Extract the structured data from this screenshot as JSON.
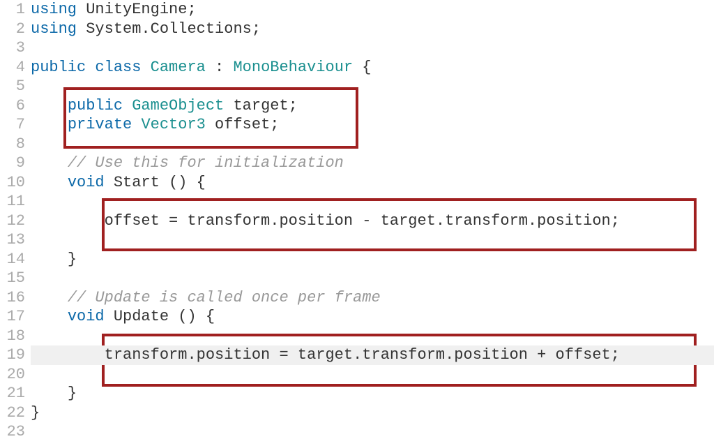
{
  "lines": {
    "l1": {
      "using": "using",
      "ns": "UnityEngine",
      "semi": ";"
    },
    "l2": {
      "using": "using",
      "ns": "System.Collections",
      "semi": ";"
    },
    "l4": {
      "public": "public",
      "class": "class",
      "name": "Camera",
      "colon": " : ",
      "base": "MonoBehaviour",
      "brace": " {"
    },
    "l6": {
      "indent": "    ",
      "public": "public",
      "type": "GameObject",
      "rest": " target;"
    },
    "l7": {
      "indent": "    ",
      "private": "private",
      "type": "Vector3",
      "rest": " offset;"
    },
    "l9": {
      "indent": "    ",
      "comment": "// Use this for initialization"
    },
    "l10": {
      "indent": "    ",
      "void": "void",
      "rest": " Start () {"
    },
    "l12": {
      "indent": "        ",
      "code": "offset = transform.position - target.transform.position;"
    },
    "l14": {
      "indent": "    ",
      "brace": "}"
    },
    "l16": {
      "indent": "    ",
      "comment": "// Update is called once per frame"
    },
    "l17": {
      "indent": "    ",
      "void": "void",
      "rest": " Update () {"
    },
    "l19": {
      "indent": "        ",
      "code": "transform.position = target.transform.position + offset;"
    },
    "l21": {
      "indent": "    ",
      "brace": "}"
    },
    "l22": {
      "brace": "}"
    }
  },
  "lineNumbers": [
    "1",
    "2",
    "3",
    "4",
    "5",
    "6",
    "7",
    "8",
    "9",
    "10",
    "11",
    "12",
    "13",
    "14",
    "15",
    "16",
    "17",
    "18",
    "19",
    "20",
    "21",
    "22",
    "23"
  ]
}
